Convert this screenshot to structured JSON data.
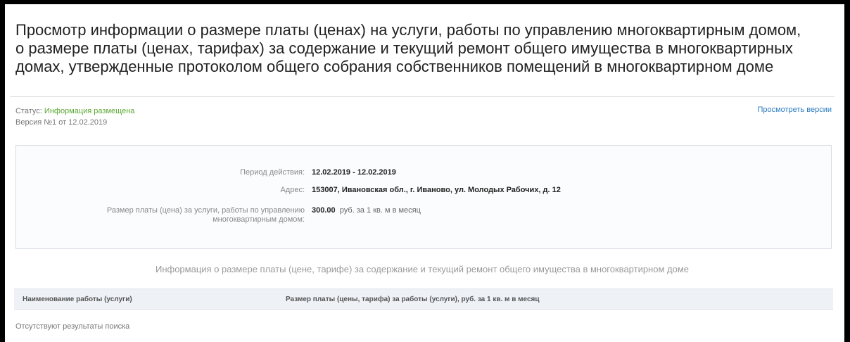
{
  "page": {
    "title_line1": "Просмотр информации о размере платы (ценах) на услуги, работы по управлению многоквартирным домом,",
    "title_line2": "о размере платы (ценах, тарифах) за содержание и текущий ремонт общего имущества в многоквартирных",
    "title_line3": "домах, утвержденные протоколом общего собрания собственников помещений в многоквартирном доме"
  },
  "status": {
    "label": "Статус:",
    "value": "Информация размещена",
    "version": "Версия №1 от 12.02.2019",
    "versions_link": "Просмотреть версии"
  },
  "details": {
    "period_label": "Период действия:",
    "period_value": "12.02.2019 - 12.02.2019",
    "address_label": "Адрес:",
    "address_value": "153007, Ивановская обл., г. Иваново, ул. Молодых Рабочих, д. 12",
    "fee_label_line1": "Размер платы (цена) за услуги, работы по управлению",
    "fee_label_line2": "многоквартирным домом:",
    "fee_amount": "300.00",
    "fee_unit": "руб. за 1 кв. м в месяц"
  },
  "section": {
    "title": "Информация о размере платы (цене, тарифе) за содержание и текущий ремонт общего имущества в многоквартирном доме"
  },
  "table": {
    "col1": "Наименование работы (услуги)",
    "col2": "Размер платы (цены, тарифа) за работы (услуги), руб. за 1 кв. м в месяц",
    "empty": "Отсутствуют результаты поиска"
  }
}
